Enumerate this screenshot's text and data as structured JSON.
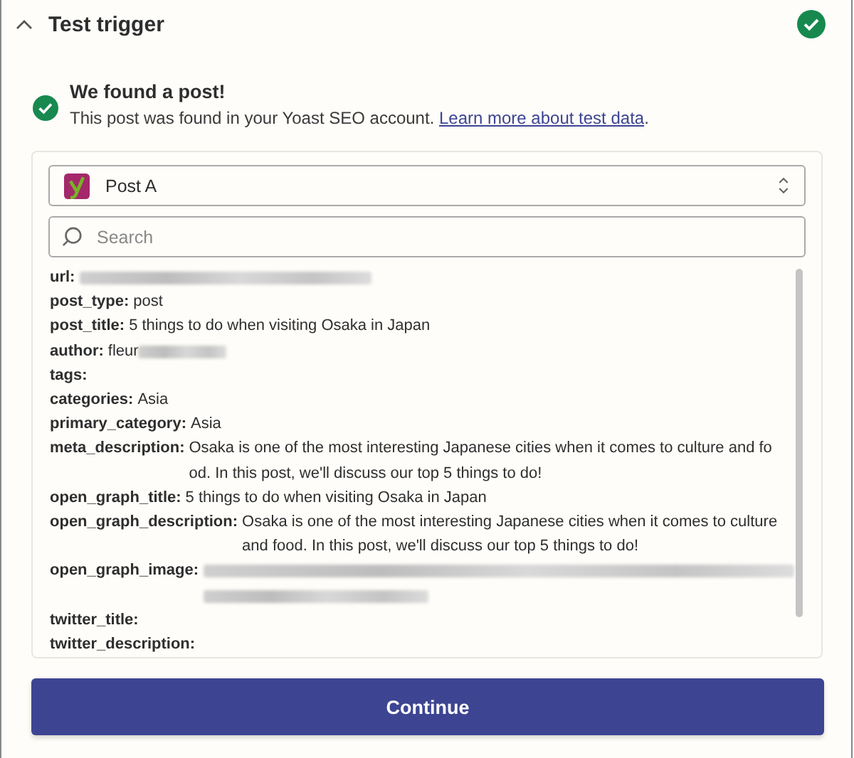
{
  "panel": {
    "title": "Test trigger",
    "expanded": true,
    "complete": true
  },
  "result": {
    "heading": "We found a post!",
    "message": "This post was found in your Yoast SEO account.",
    "link": "Learn more about test data",
    "message_end": "."
  },
  "record_select": {
    "value": "Post A"
  },
  "search": {
    "placeholder": "Search"
  },
  "fields": [
    {
      "label": "url:",
      "lines": [
        [
          {
            "kind": "longblur"
          }
        ]
      ]
    },
    {
      "label": "post_type:",
      "lines": [
        [
          {
            "kind": "text",
            "text": "post"
          }
        ]
      ]
    },
    {
      "label": "post_title:",
      "lines": [
        [
          {
            "kind": "text",
            "text": "5 things to do when visiting Osaka in Japan"
          }
        ]
      ]
    },
    {
      "label": "author:",
      "lines": [
        [
          {
            "kind": "text",
            "text": "fleur"
          },
          {
            "kind": "shortblur"
          }
        ]
      ]
    },
    {
      "label": "tags:"
    },
    {
      "label": "categories:",
      "lines": [
        [
          {
            "kind": "text",
            "text": "Asia"
          }
        ]
      ]
    },
    {
      "label": "primary_category:",
      "lines": [
        [
          {
            "kind": "text",
            "text": "Asia"
          }
        ]
      ]
    },
    {
      "label": "meta_description:",
      "lines": [
        [
          {
            "kind": "text",
            "text": "Osaka is one of the most interesting Japanese cities when it comes to culture and fo"
          }
        ],
        [
          {
            "kind": "text",
            "text": "od. In this post, we'll discuss our top 5 things to do!"
          }
        ]
      ]
    },
    {
      "label": "open_graph_title:",
      "lines": [
        [
          {
            "kind": "text",
            "text": "5 things to do when visiting Osaka in Japan"
          }
        ]
      ]
    },
    {
      "label": "open_graph_description:",
      "lines": [
        [
          {
            "kind": "text",
            "text": "Osaka is one of the most interesting Japanese cities when it comes to culture"
          }
        ],
        [
          {
            "kind": "text",
            "text": "and food. In this post, we'll discuss our top 5 things to do!"
          }
        ]
      ]
    },
    {
      "label": "open_graph_image:",
      "lines": [
        [
          {
            "kind": "fullblur"
          }
        ],
        [
          {
            "kind": "midblur"
          }
        ]
      ]
    },
    {
      "label": "twitter_title:"
    },
    {
      "label": "twitter_description:"
    }
  ],
  "continue_button": {
    "label": "Continue"
  }
}
